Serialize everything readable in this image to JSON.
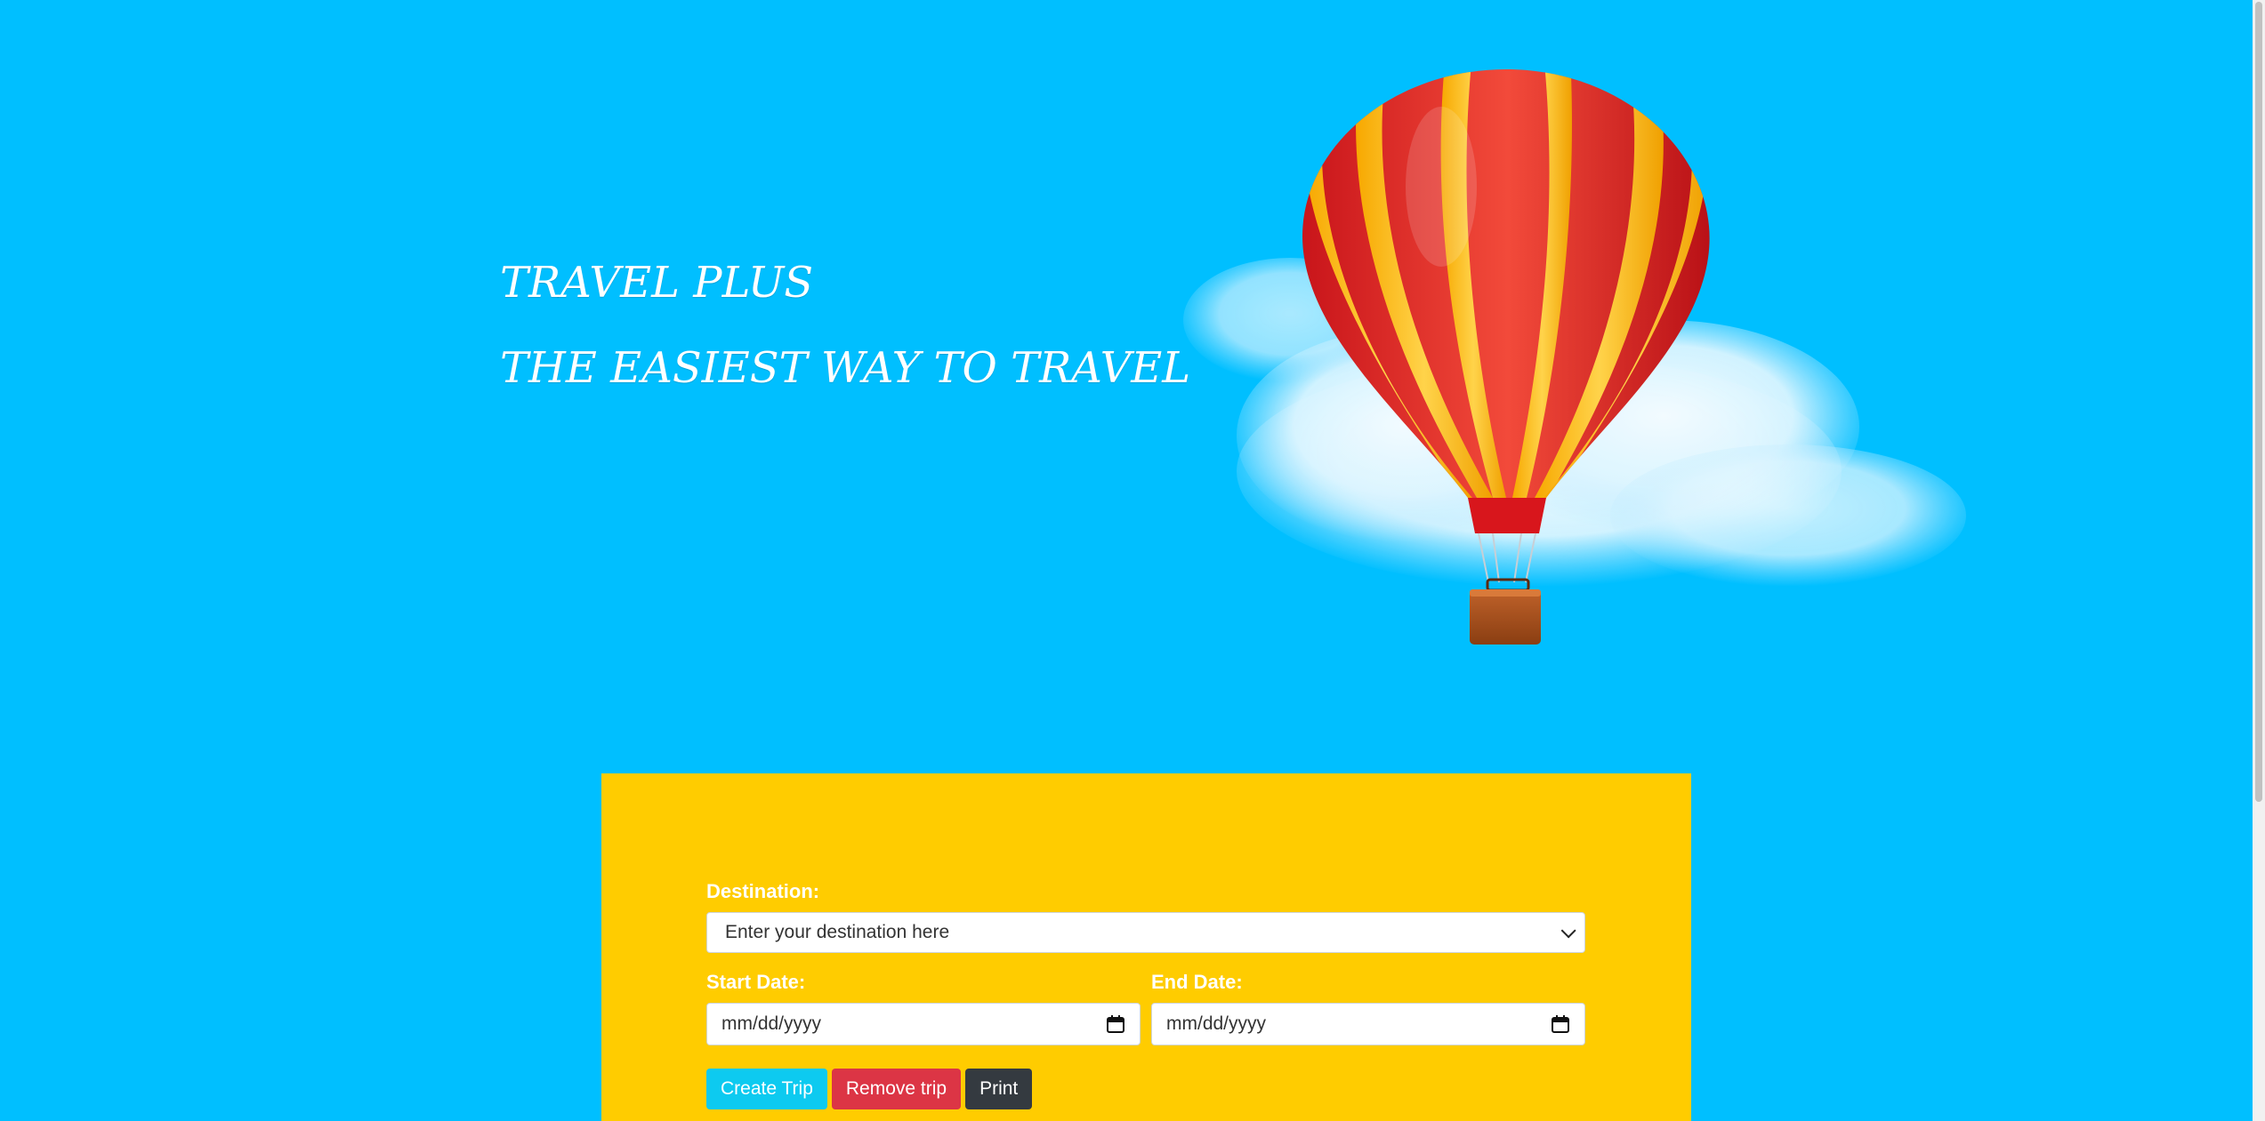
{
  "hero": {
    "title": "TRAVEL PLUS",
    "subtitle": "THE EASIEST WAY TO TRAVEL"
  },
  "form": {
    "destination_label": "Destination:",
    "destination_value": "Enter your destination here",
    "start_date_label": "Start Date:",
    "start_date_placeholder": "mm/dd/yyyy",
    "end_date_label": "End Date:",
    "end_date_placeholder": "mm/dd/yyyy"
  },
  "buttons": {
    "create": "Create Trip",
    "remove": "Remove trip",
    "print": "Print"
  },
  "colors": {
    "background": "#00bfff",
    "form_background": "#ffcc00",
    "create_button": "#0dcaf0",
    "remove_button": "#dc3545",
    "print_button": "#343a40"
  },
  "icons": [
    "hot-air-balloon-illustration",
    "cloud-illustration",
    "calendar-icon",
    "chevron-down-icon"
  ]
}
